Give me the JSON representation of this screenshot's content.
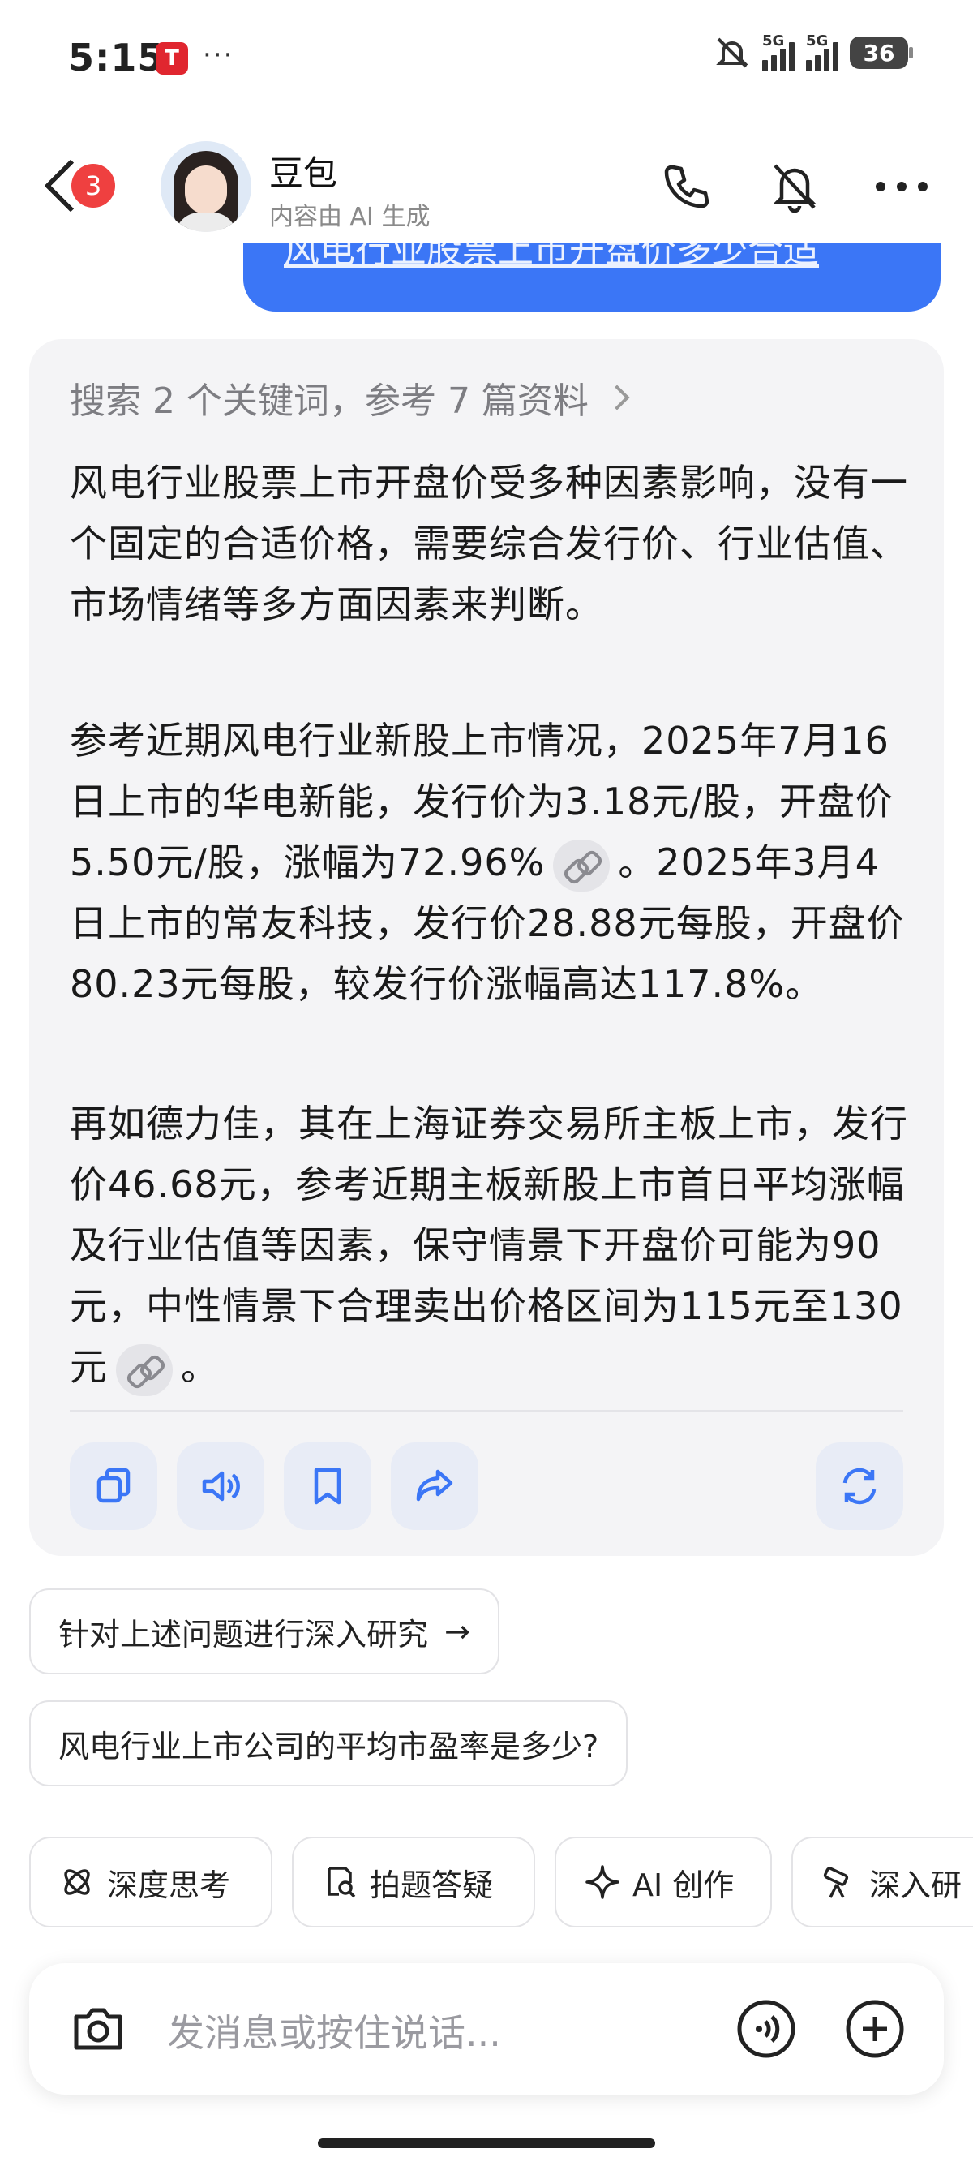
{
  "status_bar": {
    "time": "5:15",
    "app_icon": "tesla-icon",
    "dots": "···",
    "network_1": "5G",
    "network_2": "5G",
    "battery": "36"
  },
  "header": {
    "unread_count": "3",
    "title": "豆包",
    "subtitle": "内容由 AI 生成",
    "icons": [
      "back-icon",
      "phone-icon",
      "mute-icon",
      "more-icon"
    ]
  },
  "sent_message": {
    "text": "风电行业股票上市开盘价多少合适"
  },
  "answer": {
    "search_summary": "搜索 2 个关键词，参考 7 篇资料",
    "paragraph_1": "风电行业股票上市开盘价受多种因素影响，没有一个固定的合适价格，需要综合发行价、行业估值、市场情绪等多方面因素来判断。",
    "paragraph_2a": "参考近期风电行业新股上市情况，2025年7月16日上市的华电新能，发行价为3.18元/股，开盘价5.50元/股，涨幅为72.96%",
    "paragraph_2b": "。2025年3月4日上市的常友科技，发行价28.88元每股，开盘价80.23元每股，较发行价涨幅高达117.8%。",
    "paragraph_3a": "再如德力佳，其在上海证券交易所主板上市，发行价46.68元，参考近期主板新股上市首日平均涨幅及行业估值等因素，保守情景下开盘价可能为90元，中性情景下合理卖出价格区间为115元至130元",
    "paragraph_3b": "。",
    "actions": [
      "copy-icon",
      "speaker-icon",
      "bookmark-icon",
      "share-icon",
      "regenerate-icon"
    ]
  },
  "suggestions": [
    {
      "label": "针对上述问题进行深入研究",
      "arrow": "→"
    },
    {
      "label": "风电行业上市公司的平均市盈率是多少?"
    }
  ],
  "tools": [
    {
      "label": "深度思考",
      "icon": "atom-icon"
    },
    {
      "label": "拍题答疑",
      "icon": "photo-search-icon"
    },
    {
      "label": "AI 创作",
      "icon": "sparkle-icon"
    },
    {
      "label": "深入研",
      "icon": "telescope-icon"
    }
  ],
  "composer": {
    "placeholder": "发消息或按住说话...",
    "icons": [
      "camera-icon",
      "voice-icon",
      "plus-icon"
    ]
  },
  "colors": {
    "accent": "#3b76f6",
    "card_bg": "#f4f4f6",
    "badge_red": "#ef4040"
  }
}
